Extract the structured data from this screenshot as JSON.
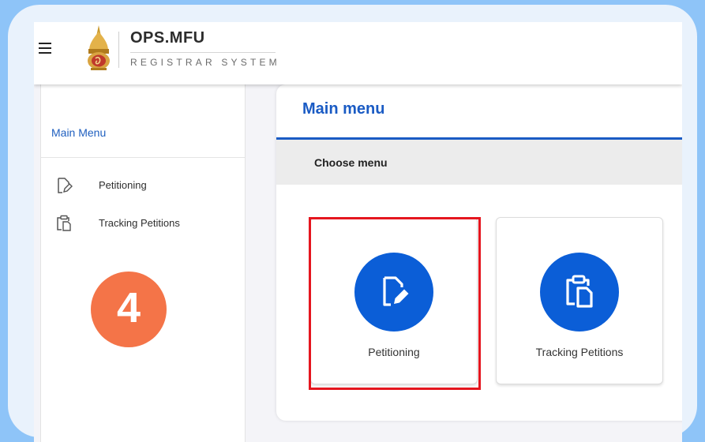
{
  "app": {
    "brand_title": "OPS.MFU",
    "brand_subtitle": "REGISTRAR SYSTEM"
  },
  "header": {
    "menu_icon": "hamburger-icon",
    "logo_icon": "university-emblem-icon"
  },
  "sidebar": {
    "heading": "Main Menu",
    "items": [
      {
        "label": "Petitioning",
        "icon": "edit-document-icon"
      },
      {
        "label": "Tracking Petitions",
        "icon": "clipboard-copy-icon"
      }
    ]
  },
  "main": {
    "title": "Main menu",
    "section_label": "Choose menu",
    "tiles": [
      {
        "label": "Petitioning",
        "icon": "edit-document-icon",
        "highlighted": true
      },
      {
        "label": "Tracking Petitions",
        "icon": "clipboard-copy-icon",
        "highlighted": false
      }
    ]
  },
  "annotation": {
    "step_number": "4",
    "badge_color": "#f47448",
    "highlight_color": "#e5161f"
  },
  "colors": {
    "accent": "#1a5bc4",
    "tile_icon_bg": "#0b5ed7",
    "background": "#8ec4f8"
  }
}
